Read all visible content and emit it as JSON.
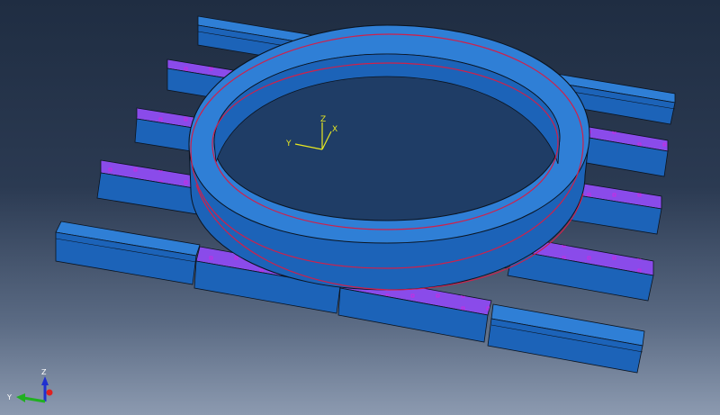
{
  "viewport": {
    "background_top": "#1f2d42",
    "background_bottom": "#8c9ab0"
  },
  "colors": {
    "block_top": "#2f7fd6",
    "block_front": "#1c63b8",
    "block_end": "#134a8e",
    "edge": "#0b1420",
    "selected_face": "#8a4bea",
    "selection_outline": "#e020e0",
    "ring_highlight": "#d0204a",
    "csys": "#e8e820",
    "triad_x": "#e02020",
    "triad_y": "#20b020",
    "triad_z": "#2030d0"
  },
  "model_csys": {
    "x_label": "X",
    "y_label": "Y",
    "z_label": "Z"
  },
  "view_triad": {
    "y_label": "Y",
    "z_label": "Z",
    "icon": "axis-triad-icon"
  }
}
